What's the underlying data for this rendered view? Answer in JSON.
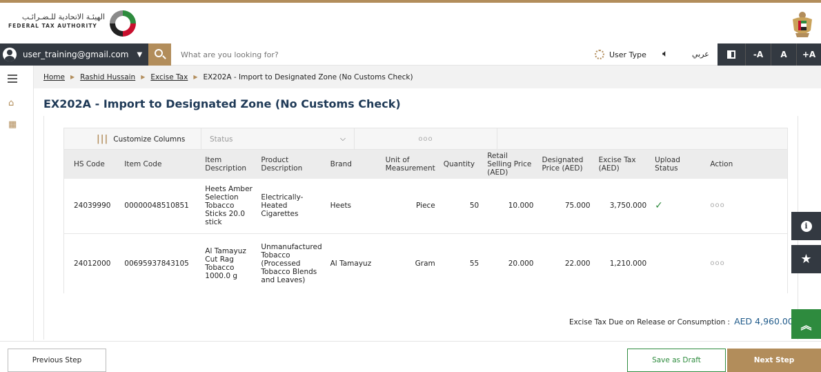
{
  "header": {
    "logo_arabic": "الهيئـة الاتحادية للـضـرائـب",
    "logo_english": "FEDERAL TAX AUTHORITY"
  },
  "topbar": {
    "user_email": "user_training@gmail.com",
    "search_placeholder": "What are you looking for?",
    "user_type_label": "User Type",
    "arabic_label": "عربي",
    "font_decrease": "-A",
    "font_normal": "A",
    "font_increase": "+A"
  },
  "breadcrumb": [
    "Home",
    "Rashid Hussain",
    "Excise Tax",
    "EX202A - Import to Designated Zone (No Customs Check)"
  ],
  "page_title": "EX202A - Import to Designated Zone (No Customs Check)",
  "table_toolbar": {
    "customize_label": "Customize Columns",
    "status_placeholder": "Status",
    "more_label": "ooo"
  },
  "table": {
    "headers": [
      "HS Code",
      "Item Code",
      "Item Description",
      "Product Description",
      "Brand",
      "Unit of Measurement",
      "Quantity",
      "Retail Selling Price (AED)",
      "Designated Price (AED)",
      "Excise Tax (AED)",
      "Upload Status",
      "Action"
    ],
    "rows": [
      {
        "hs_code": "24039990",
        "item_code": "00000048510851",
        "item_description": "Heets Amber Selection Tobacco Sticks 20.0 stick",
        "product_description": "Electrically-Heated Cigarettes",
        "brand": "Heets",
        "unit": "Piece",
        "quantity": "50",
        "retail_price": "10.000",
        "designated_price": "75.000",
        "excise_tax": "3,750.000",
        "upload_status": "✓",
        "action": "ooo"
      },
      {
        "hs_code": "24012000",
        "item_code": "00695937843105",
        "item_description": "Al Tamayuz Cut Rag Tobacco 1000.0 g",
        "product_description": "Unmanufactured Tobacco (Processed Tobacco Blends and Leaves)",
        "brand": "Al Tamayuz",
        "unit": "Gram",
        "quantity": "55",
        "retail_price": "20.000",
        "designated_price": "22.000",
        "excise_tax": "1,210.000",
        "upload_status": "",
        "action": "ooo"
      }
    ]
  },
  "total": {
    "label": "Excise Tax Due on Release or Consumption :",
    "amount": "AED 4,960.00"
  },
  "footer": {
    "previous_label": "Previous Step",
    "draft_label": "Save as Draft",
    "next_label": "Next Step"
  },
  "colors": {
    "gold": "#b28d5b",
    "dark": "#333941",
    "green": "#2e8b3e",
    "title_blue": "#1f3a57"
  }
}
